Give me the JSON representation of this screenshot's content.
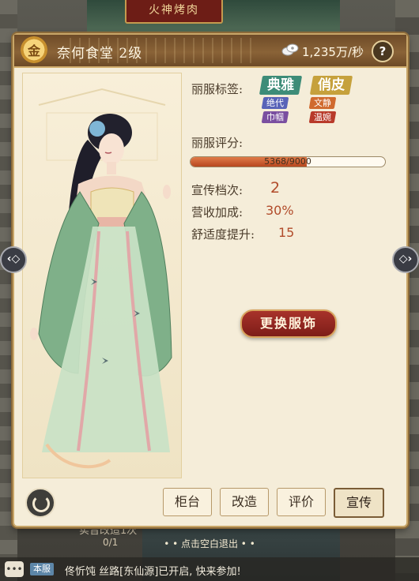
{
  "background": {
    "signboard": "火神烤肉"
  },
  "header": {
    "logo_glyph": "金",
    "shop_name": "奈何食堂 2级",
    "income": "1,235万/秒",
    "help": "?"
  },
  "info": {
    "tags_label": "丽服标签:",
    "big_tags": [
      {
        "text": "典雅",
        "color": "#3d8c78"
      },
      {
        "text": "俏皮",
        "color": "#c6a13c"
      }
    ],
    "small_tags": [
      {
        "text": "绝代",
        "color": "#5863b8"
      },
      {
        "text": "文静",
        "color": "#d06a2e"
      },
      {
        "text": "巾帼",
        "color": "#7a4fa0"
      },
      {
        "text": "温婉",
        "color": "#b83a2a"
      }
    ],
    "rating_label": "丽服评分:",
    "rating_value": 5368,
    "rating_max": 9000,
    "rating_text": "5368/9000",
    "promo_label": "宣传档次:",
    "promo_value": "2",
    "revenue_label": "营收加成:",
    "revenue_value": "30%",
    "comfort_label": "舒适度提升:",
    "comfort_value": "15"
  },
  "change_button": "更换服饰",
  "tabs": [
    {
      "label": "柜台",
      "active": false
    },
    {
      "label": "改造",
      "active": false
    },
    {
      "label": "评价",
      "active": false
    },
    {
      "label": "宣传",
      "active": true
    }
  ],
  "nav": {
    "left": "‹◇",
    "right": "◇›"
  },
  "behind": {
    "text": "实音改造1次",
    "count": "0/1"
  },
  "exit_hint": "• • 点击空白退出 • •",
  "chat": {
    "icon": "•••",
    "channel": "本服",
    "message": "佟忻饨  丝路[东仙源]已开启, 快来参加!"
  },
  "colors": {
    "accent": "#a8322a",
    "panel": "#f5edd9",
    "header": "#7b5530"
  }
}
